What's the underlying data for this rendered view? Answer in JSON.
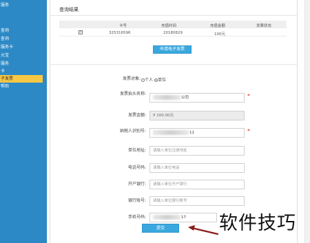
{
  "sidebar": {
    "items": [
      "服务",
      "查询",
      "查询",
      "服务卡",
      "元宝",
      "服务",
      "卡",
      "子发票",
      "帮助"
    ],
    "active_index": 7
  },
  "results": {
    "title": "查询结果",
    "columns": [
      "卡号",
      "充值时间",
      "充值金额",
      "发票状态"
    ],
    "rows": [
      {
        "checked": true,
        "card_no": "325316596",
        "time": "20180829",
        "amount": "100元",
        "status": ""
      }
    ],
    "apply_button": "申请电子发票"
  },
  "form": {
    "target": {
      "label": "发票对象:",
      "options": [
        "个人",
        "单位"
      ],
      "selected": "单位"
    },
    "title_name": {
      "label": "发票抬头名称:",
      "value": "公司"
    },
    "amount": {
      "label": "发票金额:",
      "value": "¥ 100.00元"
    },
    "tax_id": {
      "label": "纳税人识别号:",
      "value": "11"
    },
    "address": {
      "label": "单位地址:",
      "placeholder": "请输入单位注册地址"
    },
    "phone": {
      "label": "电话号码:",
      "placeholder": "请输入单位电话"
    },
    "bank": {
      "label": "开户银行:",
      "placeholder": "请输入单位开户银行"
    },
    "account": {
      "label": "银行账号:",
      "placeholder": "请输入单位银行账号"
    },
    "mobile": {
      "label": "手机号码:",
      "value": "17"
    },
    "submit": "提交"
  },
  "watermark": "软件技巧",
  "colors": {
    "sidebar": "#2c89c5",
    "active": "#f7c744",
    "button": "#3aa8de",
    "required": "#e02020",
    "arrow": "#8b1a1a"
  }
}
